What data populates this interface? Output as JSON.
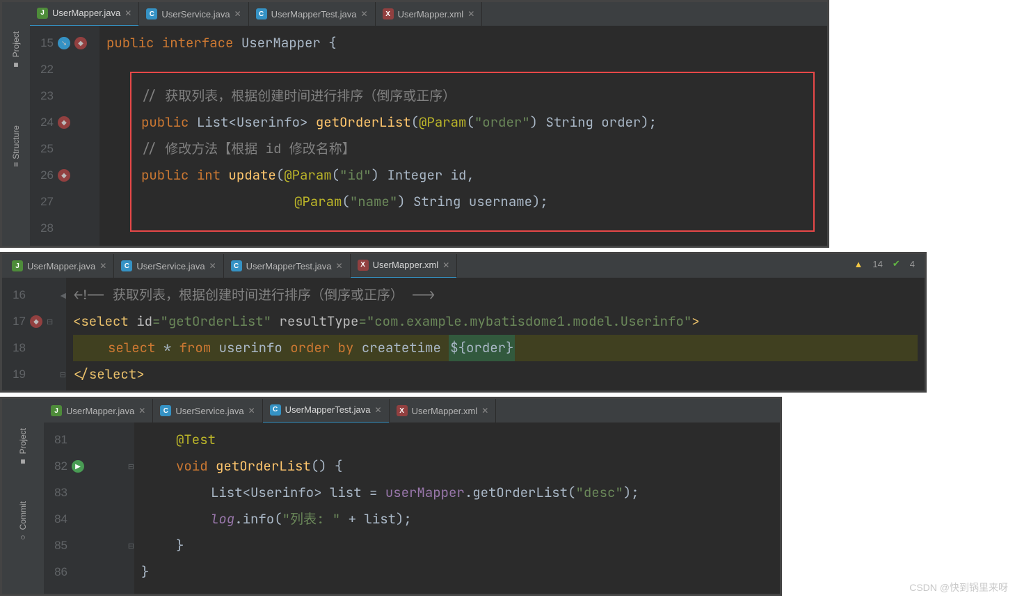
{
  "watermark": "CSDN @快到锅里来呀",
  "panel1": {
    "tools": [
      "Project",
      "Structure"
    ],
    "tabs": [
      {
        "label": "UserMapper.java",
        "icon": "j",
        "active": true
      },
      {
        "label": "UserService.java",
        "icon": "c",
        "active": false
      },
      {
        "label": "UserMapperTest.java",
        "icon": "c",
        "active": false
      },
      {
        "label": "UserMapper.xml",
        "icon": "x",
        "active": false
      }
    ],
    "lines": {
      "l15": "15",
      "l22": "22",
      "l23": "23",
      "l24": "24",
      "l25": "25",
      "l26": "26",
      "l27": "27",
      "l28": "28"
    },
    "code": {
      "pub": "public",
      "iface": " interface ",
      "name": "UserMapper ",
      "ob": "{",
      "c1": "// 获取列表，根据创建时间进行排序（倒序或正序）",
      "sig1_pub": "public ",
      "sig1_ret": "List<Userinfo> ",
      "sig1_fn": "getOrderList",
      "sig1_par": "(",
      "sig1_ann": "@Param",
      "sig1_op": "(",
      "sig1_s": "\"order\"",
      "sig1_cp": ") String order);",
      "c2": "// 修改方法【根据 id 修改名称】",
      "sig2_pub": "public ",
      "sig2_ret": "int ",
      "sig2_fn": "update",
      "sig2_par": "(",
      "sig2_ann": "@Param",
      "sig2_op": "(",
      "sig2_s": "\"id\"",
      "sig2_cp": ") Integer id,",
      "sig3_ann": "@Param",
      "sig3_op": "(",
      "sig3_s": "\"name\"",
      "sig3_cp": ") String username);"
    }
  },
  "panel2": {
    "tabs": [
      {
        "label": "UserMapper.java",
        "icon": "j",
        "active": false
      },
      {
        "label": "UserService.java",
        "icon": "c",
        "active": false
      },
      {
        "label": "UserMapperTest.java",
        "icon": "c",
        "active": false
      },
      {
        "label": "UserMapper.xml",
        "icon": "x",
        "active": true
      }
    ],
    "warn": "14",
    "ok": "4",
    "lines": {
      "l16": "16",
      "l17": "17",
      "l18": "18",
      "l19": "19"
    },
    "code": {
      "c_open": "<!-- ",
      "c_text": " 获取列表，根据创建时间进行排序（倒序或正序）  ",
      "c_close": "-->",
      "sel_open": "<",
      "sel_tag": "select ",
      "id_attr": "id",
      "eq": "=",
      "id_val": "\"getOrderList\"",
      "sp": " ",
      "rt_attr": "resultType",
      "rt_val": "\"com.example.mybatisdome1.model.Userinfo\"",
      "gt": ">",
      "sql_sel": "select ",
      "sql_star": "*",
      "sql_from": " from ",
      "sql_tbl": "userinfo ",
      "sql_ord": "order by ",
      "sql_col": "createtime ",
      "sql_ph": "${order}",
      "end_open": "</",
      "end_tag": "select",
      "end_close": ">"
    }
  },
  "panel3": {
    "tools": [
      "Project",
      "Commit"
    ],
    "tabs": [
      {
        "label": "UserMapper.java",
        "icon": "j",
        "active": false
      },
      {
        "label": "UserService.java",
        "icon": "c",
        "active": false
      },
      {
        "label": "UserMapperTest.java",
        "icon": "c",
        "active": true
      },
      {
        "label": "UserMapper.xml",
        "icon": "x",
        "active": false
      }
    ],
    "lines": {
      "l81": "81",
      "l82": "82",
      "l83": "83",
      "l84": "84",
      "l85": "85",
      "l86": "86"
    },
    "code": {
      "ann": "@Test",
      "void": "void ",
      "fn": "getOrderList",
      "sig": "() {",
      "t1": "List<Userinfo> list = ",
      "fld": "userMapper",
      "dot": ".",
      "call": "getOrderList(",
      "arg": "\"desc\"",
      "end1": ");",
      "log": "log",
      "inf": ".info(",
      "s": "\"列表: \"",
      "plus": " + list);",
      "cb": "}",
      "cb2": "}"
    }
  }
}
